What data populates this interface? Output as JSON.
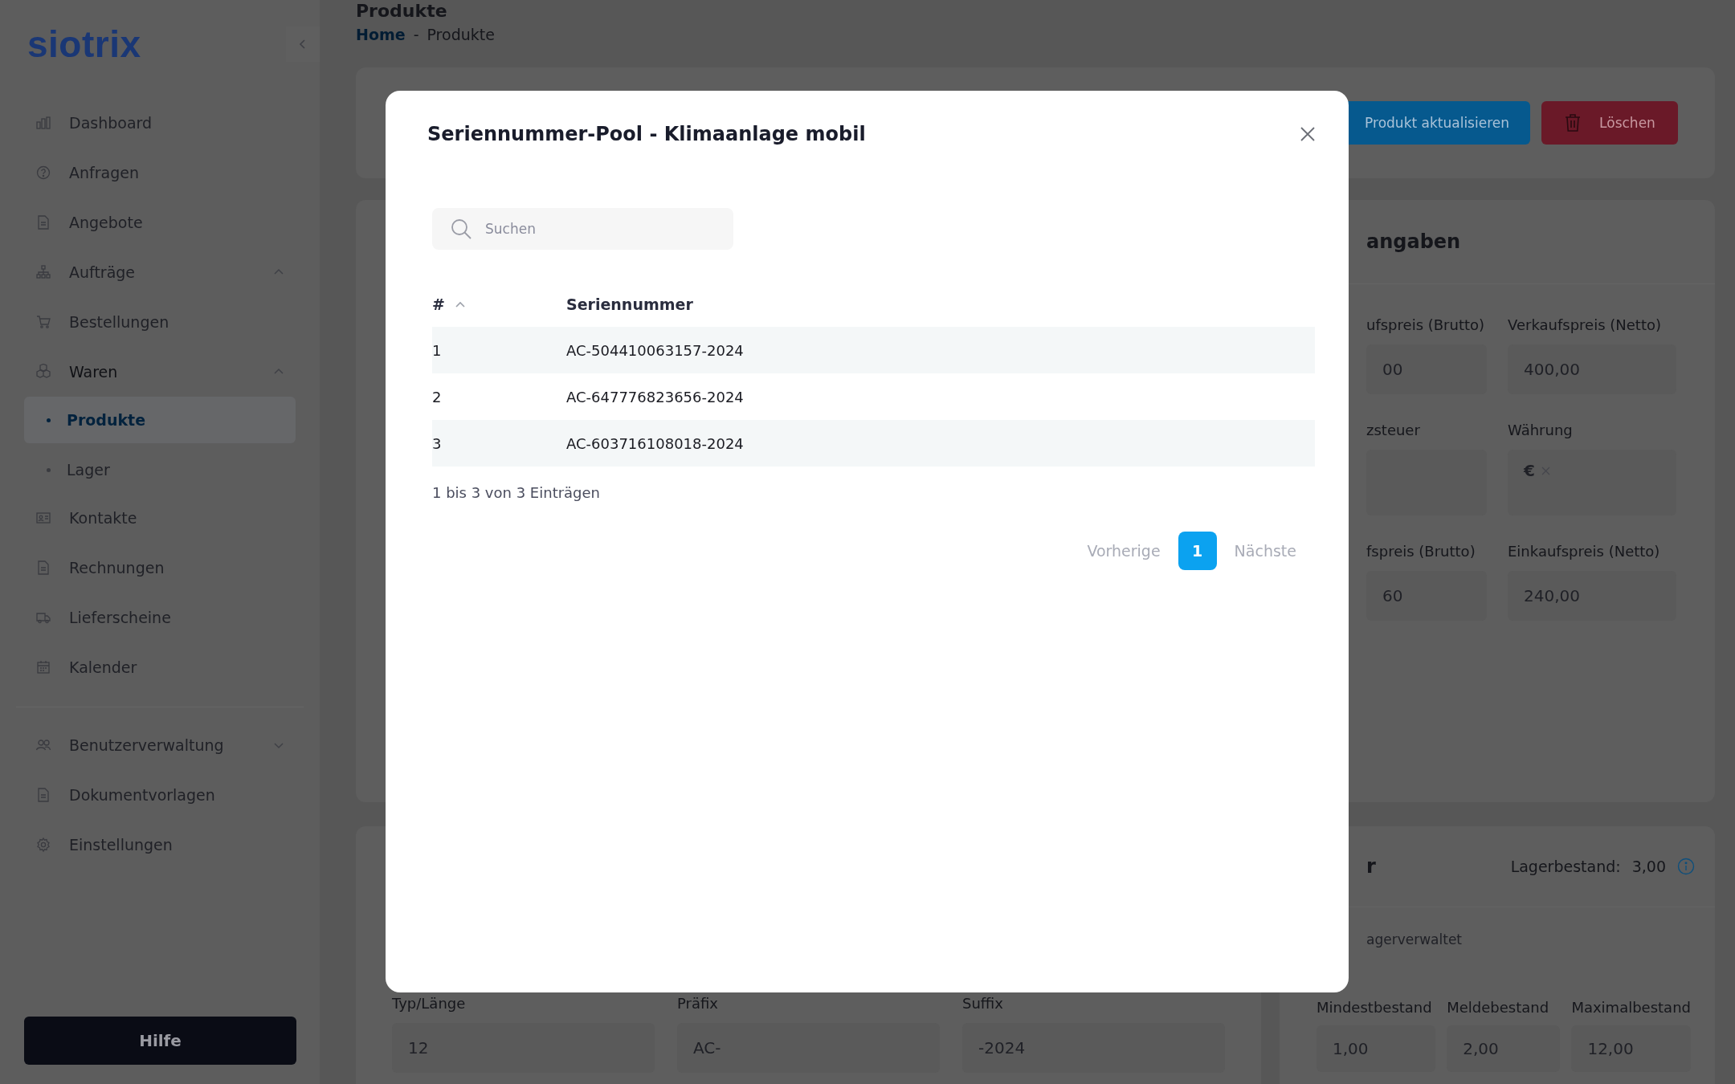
{
  "sidebar": {
    "logo": "siotrix",
    "groups": [
      [
        {
          "label": "Dashboard"
        },
        {
          "label": "Anfragen"
        },
        {
          "label": "Angebote"
        },
        {
          "label": "Aufträge",
          "expanded": true
        },
        {
          "label": "Bestellungen"
        },
        {
          "label": "Waren",
          "expanded": true,
          "children": [
            {
              "label": "Produkte",
              "selected": true
            },
            {
              "label": "Lager",
              "selected": false
            }
          ]
        },
        {
          "label": "Kontakte"
        },
        {
          "label": "Rechnungen"
        },
        {
          "label": "Lieferscheine"
        },
        {
          "label": "Kalender"
        }
      ],
      [
        {
          "label": "Benutzerverwaltung",
          "expanded": false
        },
        {
          "label": "Dokumentvorlagen"
        },
        {
          "label": "Einstellungen"
        }
      ]
    ],
    "help_button": "Hilfe"
  },
  "page": {
    "title": "Produkte",
    "breadcrumb": [
      {
        "label": "Home",
        "kind": "link"
      },
      {
        "label": "-",
        "kind": "separator"
      },
      {
        "label": "Produkte",
        "kind": "current"
      }
    ]
  },
  "actions": [
    {
      "label": "Produkt aktualisieren",
      "kind": "primary"
    },
    {
      "label": "Löschen",
      "kind": "danger"
    }
  ],
  "price_card": {
    "title": "angaben",
    "fields": [
      {
        "label": "ufspreis (Brutto)",
        "value": "00"
      },
      {
        "label": "Verkaufspreis (Netto)",
        "value": "400,00"
      },
      {
        "label": "zsteuer"
      },
      {
        "label": "Währung",
        "tag": "€"
      },
      {
        "label": "fspreis (Brutto)",
        "value": "60"
      },
      {
        "label": "Einkaufspreis (Netto)",
        "value": "240,00"
      }
    ]
  },
  "serial_card": {
    "fields": [
      {
        "label": "Typ/Länge",
        "value": "12"
      },
      {
        "label": "Präfix",
        "value": "AC-"
      },
      {
        "label": "Suffix",
        "value": "-2024"
      }
    ]
  },
  "stock_card": {
    "title": "r",
    "stock_label": "Lagerbestand:",
    "stock_value": "3,00",
    "note": "agerverwaltet",
    "fields": [
      {
        "label": "Mindestbestand",
        "value": "1,00"
      },
      {
        "label": "Meldebestand",
        "value": "2,00"
      },
      {
        "label": "Maximalbestand",
        "value": "12,00"
      }
    ]
  },
  "modal": {
    "title": "Seriennummer-Pool - Klimaanlage mobil",
    "search": {
      "placeholder": "Suchen"
    },
    "table": {
      "columns": [
        {
          "label": "#",
          "sorted": true
        },
        {
          "label": "Seriennummer",
          "sorted": false
        }
      ],
      "rows": [
        [
          "1",
          "AC-504410063157-2024"
        ],
        [
          "2",
          "AC-647776823656-2024"
        ],
        [
          "3",
          "AC-603716108018-2024"
        ]
      ]
    },
    "info": "1 bis 3 von 3 Einträgen",
    "pagination": {
      "previous": {
        "label": "Vorherige",
        "disabled": true
      },
      "pages": [
        {
          "label": "1",
          "selected": true
        }
      ],
      "next": {
        "label": "Nächste",
        "disabled": true
      }
    }
  }
}
